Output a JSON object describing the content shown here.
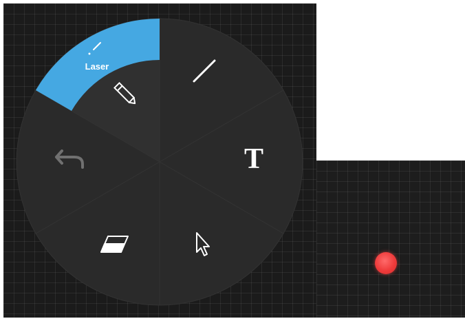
{
  "menu": {
    "active_tool_label": "Laser",
    "tools": [
      {
        "id": "pen",
        "icon": "pencil-icon",
        "state": "active"
      },
      {
        "id": "line",
        "icon": "line-icon"
      },
      {
        "id": "text",
        "icon": "text-tool-icon",
        "glyph": "T"
      },
      {
        "id": "select",
        "icon": "cursor-pointer-icon"
      },
      {
        "id": "eraser",
        "icon": "eraser-icon"
      },
      {
        "id": "undo",
        "icon": "undo-icon",
        "state": "disabled"
      }
    ]
  },
  "laser_pointer": {
    "color": "#ef3b3b"
  },
  "colors": {
    "canvas": "#1b1b1b",
    "menu_fill": "#2a2a2a",
    "menu_divider": "#333333",
    "accent": "#45a8e2"
  }
}
